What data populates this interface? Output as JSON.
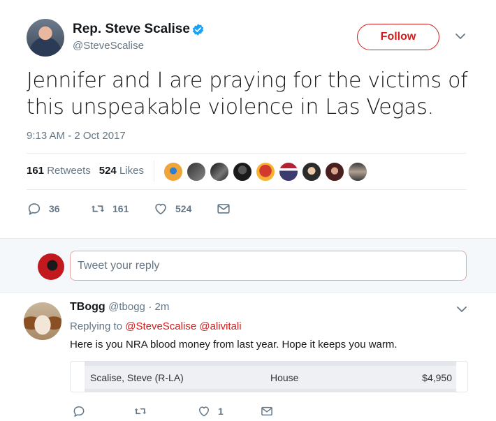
{
  "tweet": {
    "author_name": "Rep. Steve Scalise",
    "author_handle": "@SteveScalise",
    "follow_label": "Follow",
    "text": "Jennifer and I are praying for the victims of this unspeakable violence in Las Vegas.",
    "timestamp": "9:13 AM - 2 Oct 2017",
    "retweets_count": "161",
    "retweets_label": "Retweets",
    "likes_count": "524",
    "likes_label": "Likes",
    "liker_avatar_count": 9,
    "actions": {
      "reply_count": "36",
      "retweet_count": "161",
      "like_count": "524"
    },
    "icons": [
      "verified-badge-icon",
      "chevron-down-icon",
      "reply-icon",
      "retweet-icon",
      "heart-icon",
      "message-icon"
    ]
  },
  "reply_box": {
    "placeholder": "Tweet your reply"
  },
  "reply": {
    "author_name": "TBogg",
    "author_handle": "@tbogg",
    "age": "· 2m",
    "replying_label": "Replying to",
    "mentions": [
      "@SteveScalise",
      "@alivitali"
    ],
    "text": "Here is you NRA blood money from last year. Hope it keeps you warm.",
    "card": {
      "name": "Scalise, Steve (R-LA)",
      "chamber": "House",
      "amount": "$4,950"
    },
    "actions": {
      "reply_count": "",
      "retweet_count": "",
      "like_count": "1"
    }
  },
  "colors": {
    "accent": "#d31c1c",
    "verified": "#1da1f2",
    "muted_text": "#657786",
    "reply_bg": "#f5f8fa"
  }
}
